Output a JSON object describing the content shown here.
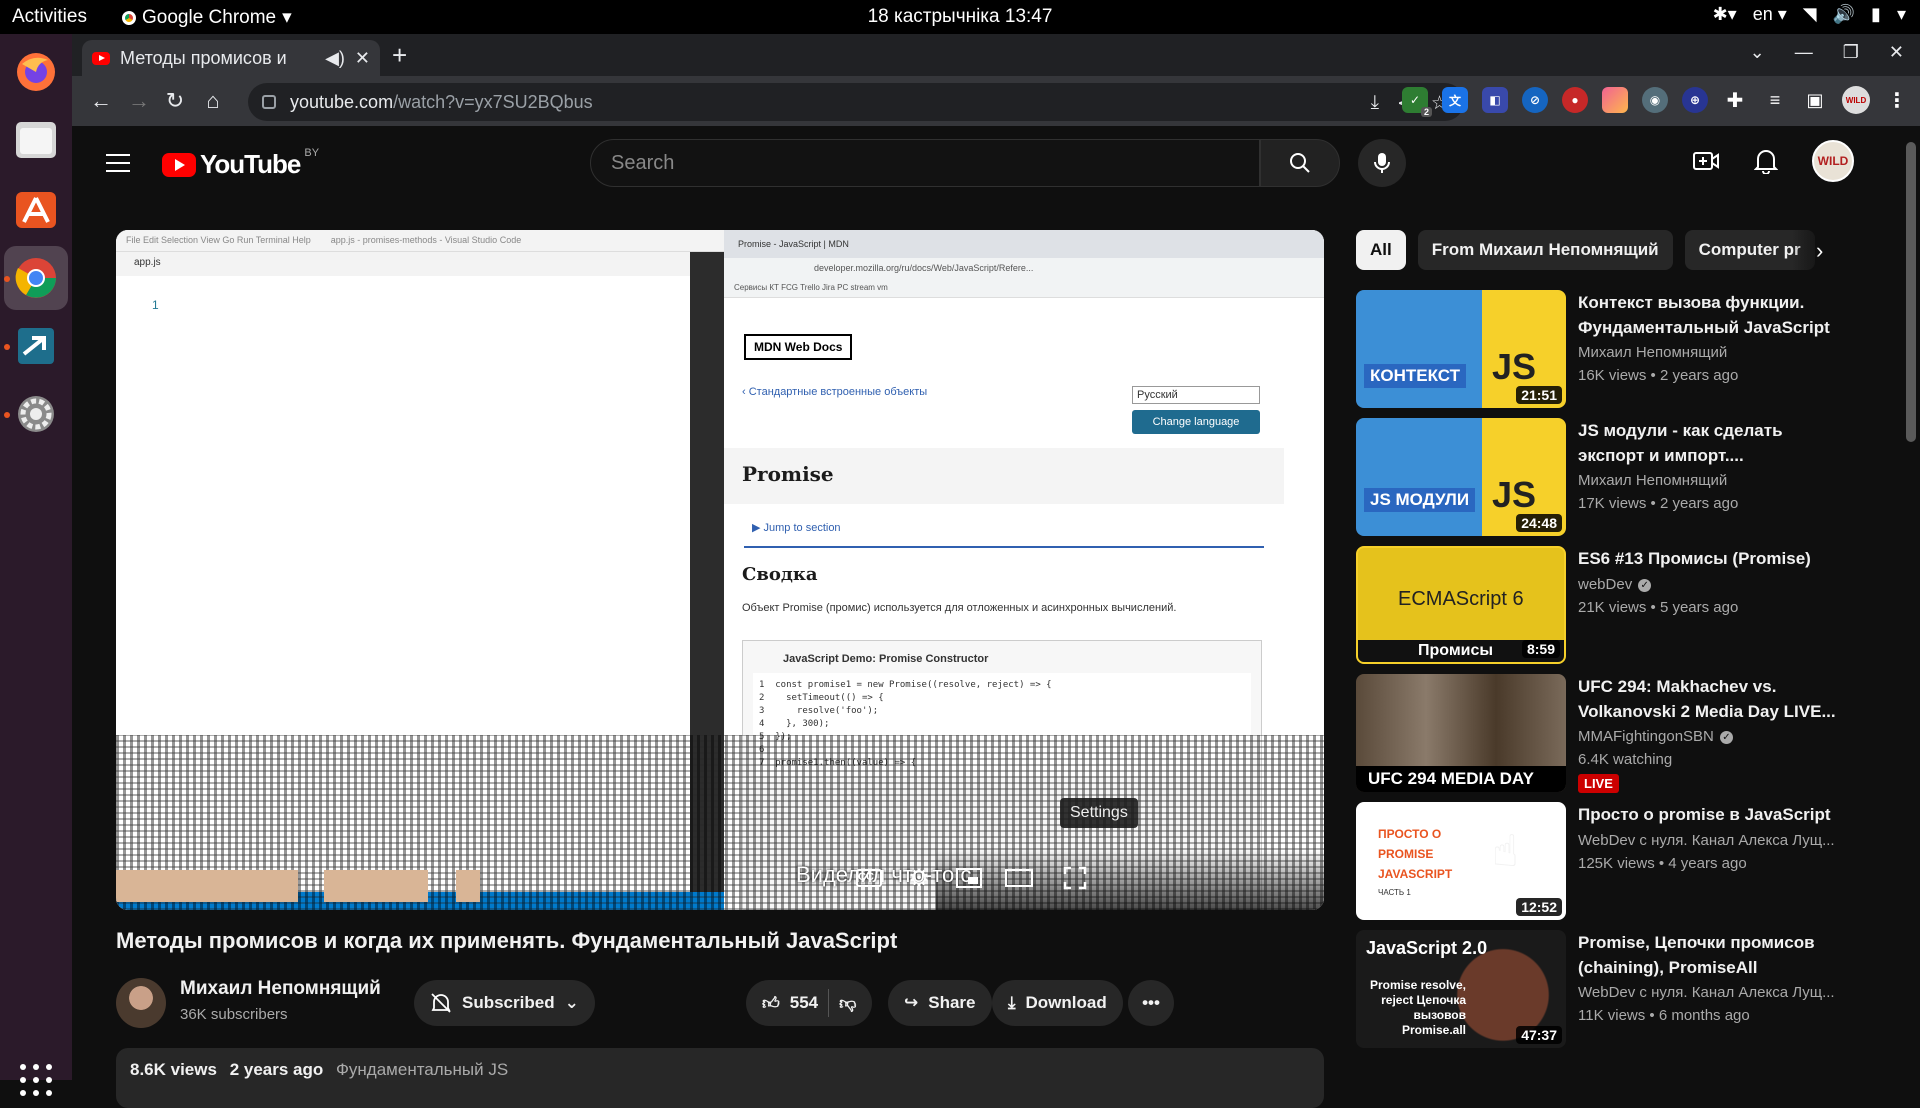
{
  "system": {
    "activities": "Activities",
    "app_name": "Google Chrome",
    "clock": "18 кастрычніка  13:47",
    "keyboard_lang": "en"
  },
  "browser": {
    "tab_title": "Методы промисов и",
    "url_host": "youtube.com",
    "url_path": "/watch?v=yx7SU2BQbus",
    "profile_badge": "WILD",
    "ext_badge_count": "2"
  },
  "youtube": {
    "logo_word": "YouTube",
    "country_code": "BY",
    "search_placeholder": "Search",
    "account_avatar": "WILD",
    "video": {
      "title": "Методы промисов и когда их применять. Фундаментальный JavaScript",
      "channel": "Михаил Непомнящий",
      "subscribers": "36K subscribers",
      "subscribed_label": "Subscribed",
      "likes": "554",
      "share_label": "Share",
      "download_label": "Download",
      "views": "8.6K views",
      "age": "2 years ago",
      "playlist_tag": "Фундаментальный JS",
      "tooltip": "Settings",
      "caption_text": "Виделил что-то с"
    },
    "embedded": {
      "vscode_title": "app.js - promises-methods - Visual Studio Code",
      "vscode_tab": "app.js",
      "vscode_menu": "File   Edit   Selection   View   Go   Run   Terminal   Help",
      "line_number": "1",
      "browser_tab": "Promise - JavaScript | MDN",
      "browser_url": "developer.mozilla.org/ru/docs/Web/JavaScript/Refere...",
      "bookmarks": "Сервисы   КТ   FCG   Trello   Jira   PC   stream   vm",
      "mdn_logo": "MDN Web Docs",
      "mdn_crumb": "‹ Стандартные встроенные объекты",
      "mdn_lang": "Русский",
      "mdn_change": "Change language",
      "mdn_h1": "Promise",
      "mdn_jump": "▶  Jump to section",
      "mdn_h2": "Сводка",
      "mdn_p": "Объект Promise (промис) используется для отложенных и асинхронных вычислений.",
      "mdn_demo_title": "JavaScript Demo: Promise Constructor",
      "mdn_code": "1  const promise1 = new Promise((resolve, reject) => {\n2    setTimeout(() => {\n3      resolve('foo');\n4    }, 300);\n5  });\n6\n7  promise1.then((value) => {"
    },
    "filter_chips": [
      "All",
      "From Михаил Непомнящий",
      "Computer pr"
    ],
    "recommendations": [
      {
        "title": "Контекст вызова функции. Фундаментальный JavaScript",
        "channel": "Михаил Непомнящий",
        "meta": "16K views  • 2 years ago",
        "duration": "21:51",
        "thumb_label": "КОНТЕКСТ",
        "thumb_js": "JS"
      },
      {
        "title": "JS модули - как сделать экспорт и импорт....",
        "channel": "Михаил Непомнящий",
        "meta": "17K views  • 2 years ago",
        "duration": "24:48",
        "thumb_label": "JS МОДУЛИ",
        "thumb_js": "JS"
      },
      {
        "title": "ES6 #13 Промисы (Promise)",
        "channel": "webDev",
        "meta": "21K views  • 5 years ago",
        "duration": "8:59",
        "thumb_label": "ECMAScript 6",
        "thumb_js": "Промисы"
      },
      {
        "title": "UFC 294: Makhachev vs. Volkanovski 2 Media Day LIVE...",
        "channel": "MMAFightingonSBN",
        "meta": "6.4K watching",
        "live": "LIVE",
        "thumb_label": "UFC 294 MEDIA DAY"
      },
      {
        "title": "Просто о promise в JavaScript",
        "channel": "WebDev с нуля. Канал Алекса Лущ...",
        "meta": "125K views  • 4 years ago",
        "duration": "12:52",
        "thumb_label": "ПРОСТО О PROMISE JAVASCRIPT",
        "thumb_js": "ЧАСТЬ 1"
      },
      {
        "title": "Promise, Цепочки промисов (chaining), PromiseAll",
        "channel": "WebDev с нуля. Канал Алекса Лущ...",
        "meta": "11K views  • 6 months ago",
        "duration": "47:37",
        "thumb_label": "JavaScript 2.0",
        "thumb_js": "Promise resolve, reject Цепочка вызовов Promise.all"
      }
    ]
  }
}
